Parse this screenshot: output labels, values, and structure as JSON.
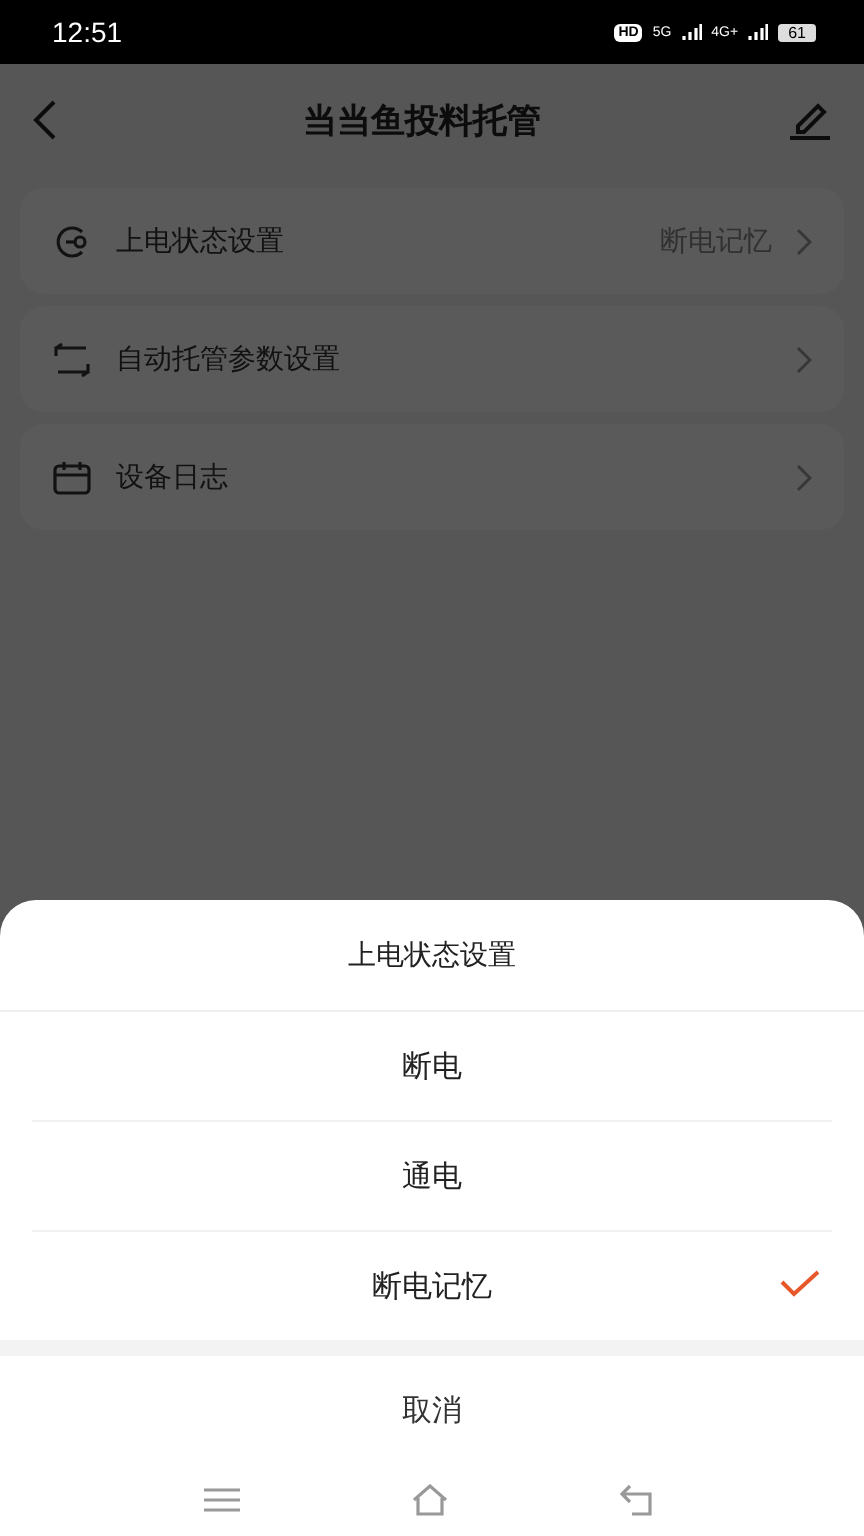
{
  "status_bar": {
    "time": "12:51",
    "hd": "HD",
    "net_1": "5G",
    "net_2": "4G+",
    "battery": "61"
  },
  "header": {
    "title": "当当鱼投料托管"
  },
  "menu": [
    {
      "kind": "power",
      "label": "上电状态设置",
      "value": "断电记忆"
    },
    {
      "kind": "cycle",
      "label": "自动托管参数设置"
    },
    {
      "kind": "calendar",
      "label": "设备日志"
    }
  ],
  "sheet": {
    "title": "上电状态设置",
    "options": [
      {
        "label": "断电",
        "selected": false
      },
      {
        "label": "通电",
        "selected": false
      },
      {
        "label": "断电记忆",
        "selected": true
      }
    ],
    "cancel": "取消"
  }
}
